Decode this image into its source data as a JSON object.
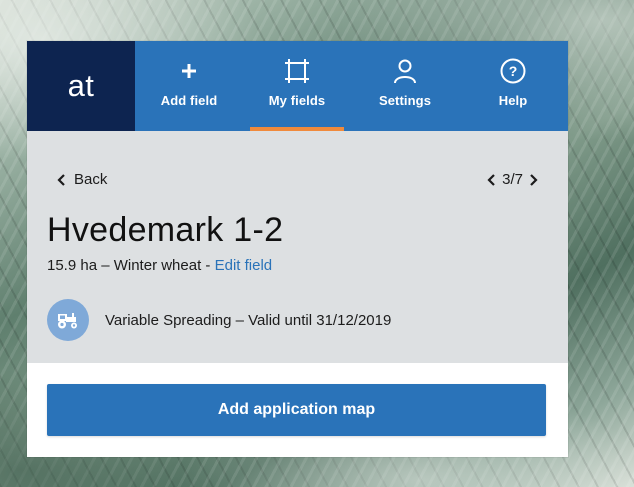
{
  "nav": {
    "logo_text": "at",
    "items": [
      {
        "label": "Add field",
        "icon": "plus-icon"
      },
      {
        "label": "My fields",
        "icon": "field-frame-icon",
        "active": true
      },
      {
        "label": "Settings",
        "icon": "user-icon"
      },
      {
        "label": "Help",
        "icon": "question-circle-icon"
      }
    ]
  },
  "field": {
    "back_label": "Back",
    "pager": "3/7",
    "title": "Hvedemark 1-2",
    "area_crop": "15.9 ha – Winter wheat - ",
    "edit_label": "Edit field",
    "license_icon": "tractor-icon",
    "license_text": "Variable Spreading – Valid until 31/12/2019"
  },
  "actions": {
    "add_map_label": "Add application map"
  },
  "colors": {
    "nav_blue": "#2a73b9",
    "logo_navy": "#0d2450",
    "active_underline": "#f08a3c",
    "panel_bg": "#dde0e2",
    "badge_blue": "#7fa9d8"
  }
}
